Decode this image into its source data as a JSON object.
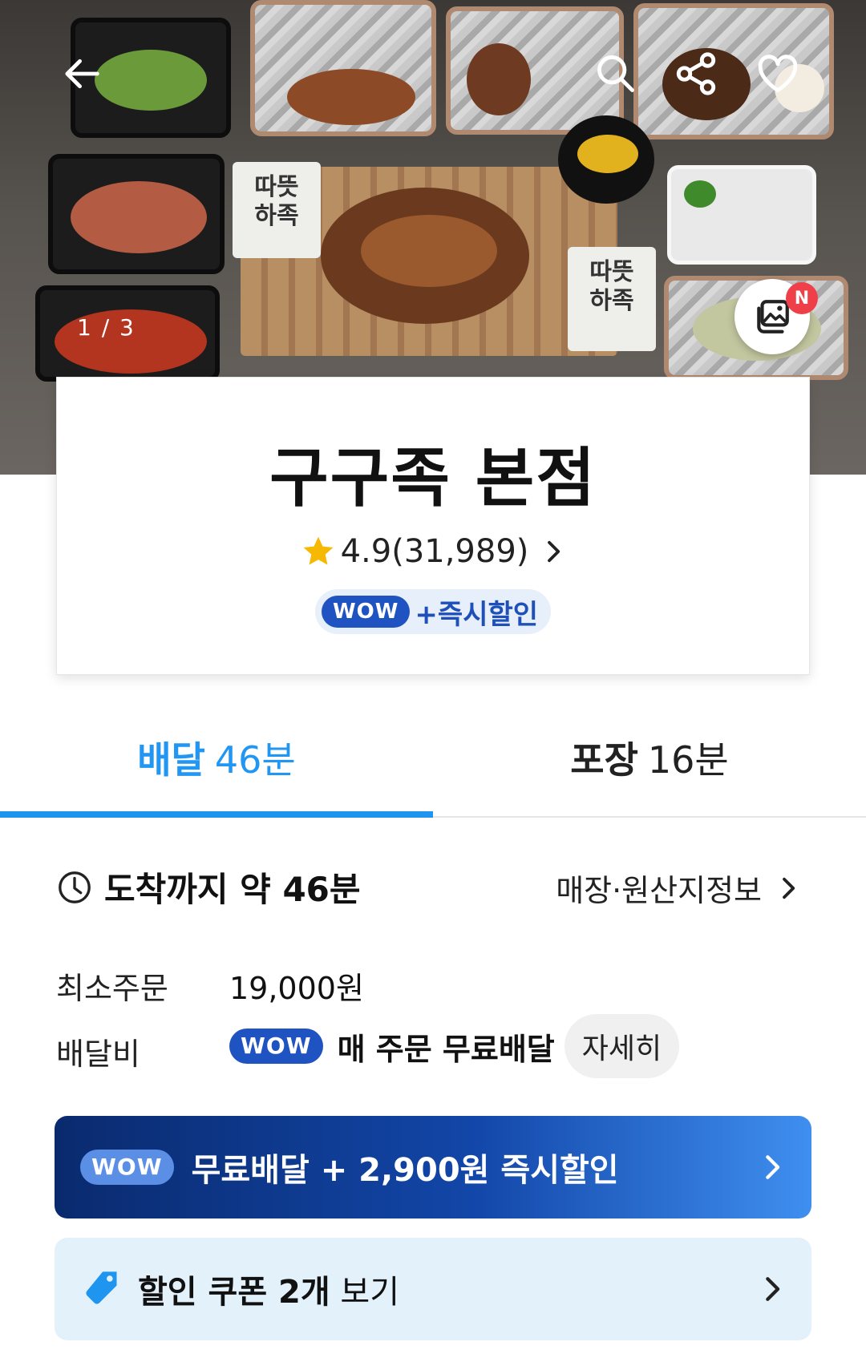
{
  "hero": {
    "image_counter": "1 / 3",
    "package_label_1": "따뜻\n하족",
    "package_label_2": "따뜻\n하족",
    "new_badge": "N",
    "icons": [
      "back-arrow-icon",
      "search-icon",
      "share-icon",
      "heart-icon",
      "photo-gallery-icon"
    ]
  },
  "store": {
    "name": "구구족 본점",
    "rating": "4.9(31,989)",
    "wow_badge": "WOW",
    "wow_promo": "+즉시할인"
  },
  "tabs": [
    {
      "label": "배달",
      "time": "46분",
      "active": true
    },
    {
      "label": "포장",
      "time": "16분",
      "active": false
    }
  ],
  "info": {
    "arrival": "도착까지 약 46분",
    "store_info_link": "매장·원산지정보",
    "min_order_label": "최소주문",
    "min_order_value": "19,000원",
    "delivery_fee_label": "배달비",
    "delivery_fee_badge": "WOW",
    "delivery_fee_text": "매 주문 무료배달",
    "detail_button": "자세히"
  },
  "banners": {
    "wow_badge": "WOW",
    "wow_text": "무료배달 + 2,900원 즉시할인",
    "coupon_bold": "할인 쿠폰 2개",
    "coupon_rest": " 보기"
  },
  "colors": {
    "accent_blue": "#1e95ee",
    "wow_blue": "#1f53c1",
    "new_badge_red": "#ef4049",
    "star_yellow": "#f6b800"
  }
}
